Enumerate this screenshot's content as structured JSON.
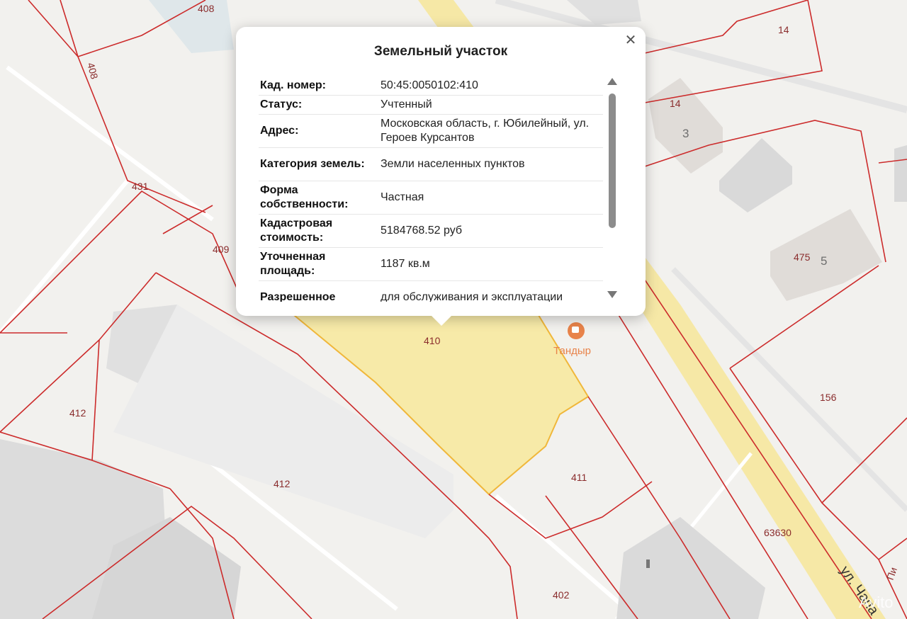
{
  "popup": {
    "title": "Земельный участок",
    "close_icon": "close-icon",
    "rows": [
      {
        "key": "Кад. номер:",
        "value": "50:45:0050102:410"
      },
      {
        "key": "Статус:",
        "value": "Учтенный"
      },
      {
        "key": "Адрес:",
        "value": "Московская область, г. Юбилейный, ул. Героев Курсантов"
      },
      {
        "key": "Категория земель:",
        "value": "Земли населенных пунктов"
      },
      {
        "key": "Форма собственности:",
        "value": "Частная"
      },
      {
        "key": "Кадастровая стоимость:",
        "value": "5184768.52 руб"
      },
      {
        "key": "Уточненная площадь:",
        "value": "1187 кв.м"
      },
      {
        "key": "Разрешенное",
        "value": "для обслуживания и эксплуатации"
      }
    ]
  },
  "map": {
    "plot_numbers": [
      "408",
      "408",
      "14",
      "14",
      "431",
      "409",
      "410",
      "475",
      "156",
      "412",
      "412",
      "411",
      "63630",
      "402"
    ],
    "building_numbers": [
      "3",
      "5"
    ],
    "poi": {
      "label": "Тандыр",
      "icon": "cafe-icon"
    },
    "street": "ул. Чапа",
    "street_partial": "Пи",
    "watermark": "Avito"
  },
  "colors": {
    "boundary": "#cc2b2b",
    "selected_plot": "#f7e9a0",
    "road": "#f6e8a6",
    "building": "#dcdcdc",
    "poi": "#e8834a"
  }
}
